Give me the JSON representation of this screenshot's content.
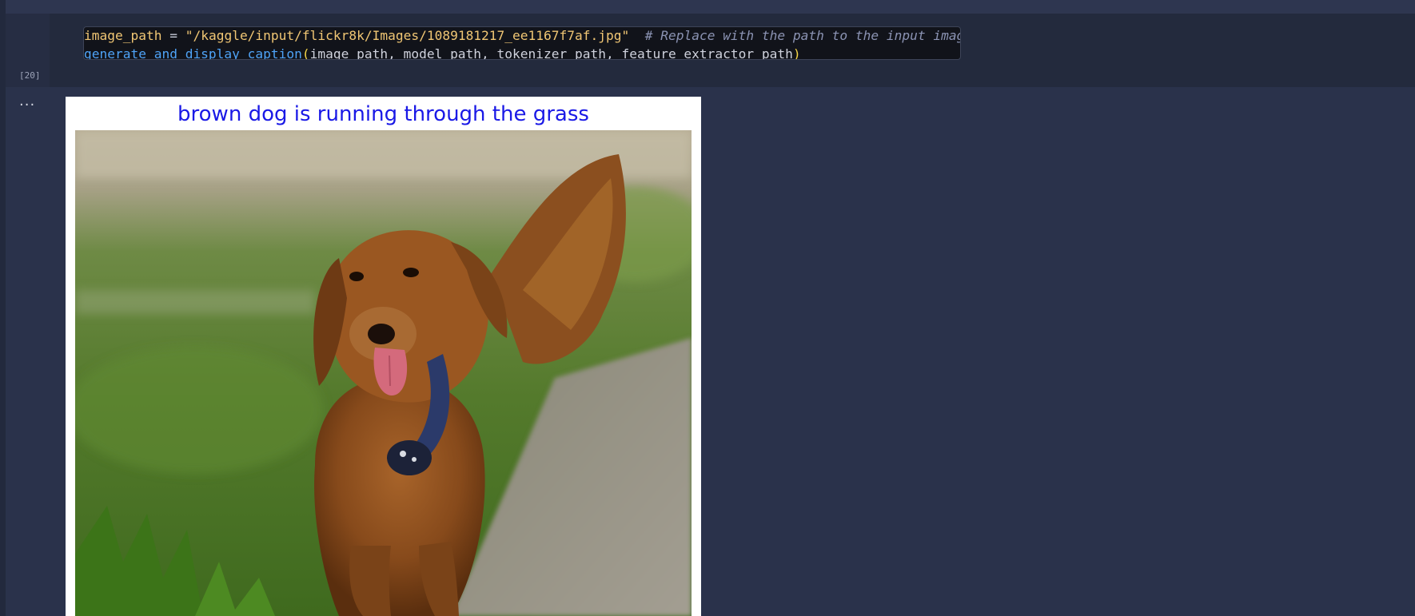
{
  "cell": {
    "execution_count": "[20]",
    "code_lines": [
      {
        "tokens": [
          {
            "text": "image_path",
            "cls": "tok-var"
          },
          {
            "text": " = ",
            "cls": "tok-op"
          },
          {
            "text": "\"/kaggle/input/flickr8k/Images/1089181217_ee1167f7af.jpg\"",
            "cls": "tok-str"
          },
          {
            "text": "  ",
            "cls": "tok-op"
          },
          {
            "text": "# Replace with the path to the input image",
            "cls": "tok-cmt"
          }
        ]
      },
      {
        "tokens": [
          {
            "text": "generate_and_display_caption",
            "cls": "tok-fn"
          },
          {
            "text": "(",
            "cls": "tok-paren"
          },
          {
            "text": "image_path, model_path, tokenizer_path, feature_extractor_path",
            "cls": "tok-arg"
          },
          {
            "text": ")",
            "cls": "tok-paren"
          }
        ]
      }
    ]
  },
  "output": {
    "more_label": "...",
    "figure_title": "brown dog is running through the grass",
    "title_color": "#1a19e6"
  },
  "icons": {
    "output_actions": "ellipsis-icon"
  },
  "colors": {
    "background": "#2a324b",
    "code_background": "#11131a",
    "string": "#f0c674",
    "function": "#4fa3f7",
    "comment": "#8b93b3"
  }
}
